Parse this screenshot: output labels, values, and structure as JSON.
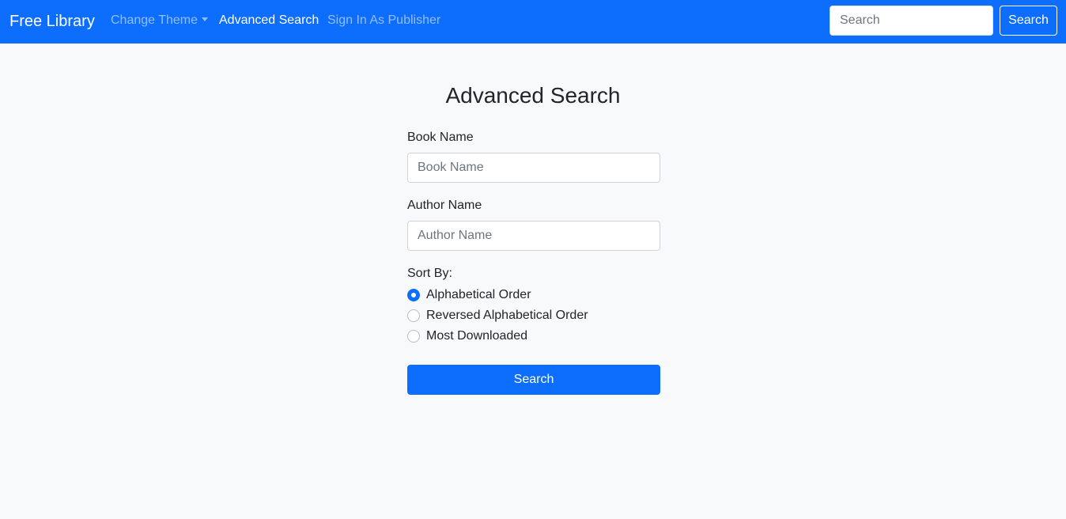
{
  "navbar": {
    "brand": "Free Library",
    "links": [
      {
        "label": "Change Theme",
        "dropdown": true
      },
      {
        "label": "Advanced Search",
        "active": true
      },
      {
        "label": "Sign In As Publisher"
      }
    ],
    "search": {
      "placeholder": "Search",
      "value": "",
      "button_label": "Search"
    },
    "background_color": "#0d6efd"
  },
  "main": {
    "title": "Advanced Search",
    "book_name": {
      "label": "Book Name",
      "placeholder": "Book Name",
      "value": ""
    },
    "author_name": {
      "label": "Author Name",
      "placeholder": "Author Name",
      "value": ""
    },
    "sort": {
      "label": "Sort By:",
      "options": [
        {
          "label": "Alphabetical Order",
          "selected": true
        },
        {
          "label": "Reversed Alphabetical Order",
          "selected": false
        },
        {
          "label": "Most Downloaded",
          "selected": false
        }
      ]
    },
    "submit_label": "Search",
    "accent_color": "#0d6efd"
  }
}
